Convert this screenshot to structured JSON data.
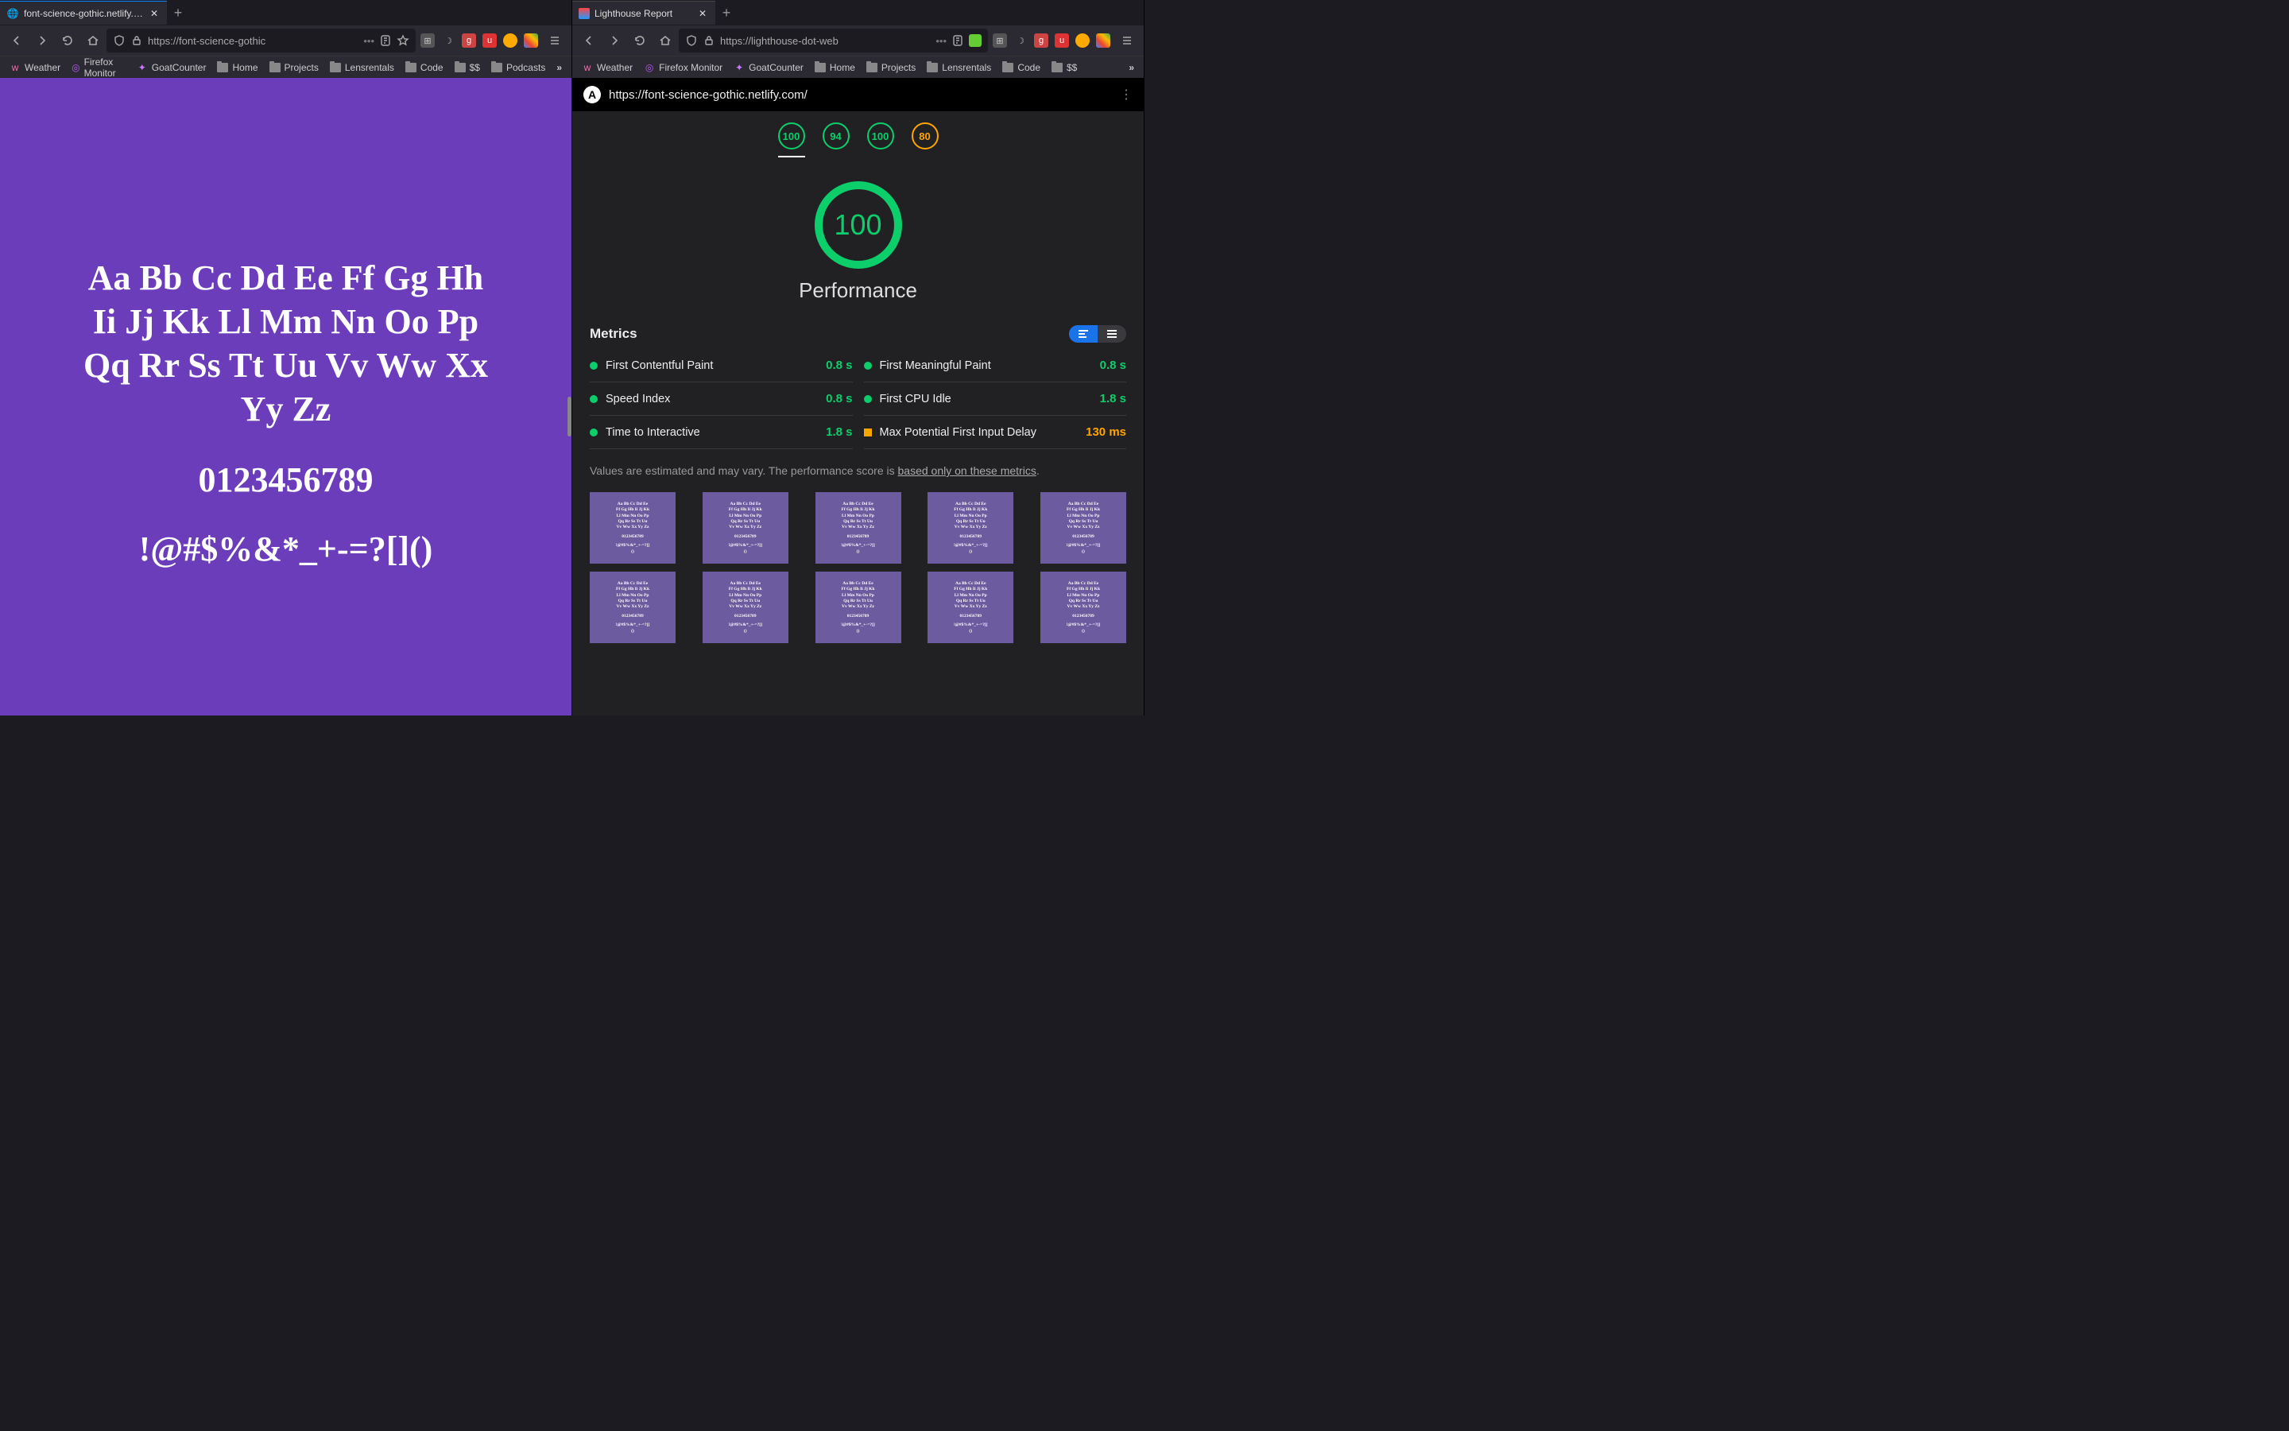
{
  "left": {
    "tab": {
      "title": "font-science-gothic.netlify.com/"
    },
    "url": "https://font-science-gothic",
    "bookmarks": [
      "Weather",
      "Firefox Monitor",
      "GoatCounter",
      "Home",
      "Projects",
      "Lensrentals",
      "Code",
      "$$",
      "Podcasts"
    ],
    "specimen": {
      "row1": "Aa Bb Cc Dd Ee Ff Gg Hh",
      "row2": "Ii Jj Kk Ll Mm Nn Oo Pp",
      "row3": "Qq Rr Ss Tt Uu Vv Ww Xx",
      "row4": "Yy Zz",
      "nums": "0123456789",
      "syms": "!@#$%&*_+-=?[]()"
    }
  },
  "right": {
    "tab": {
      "title": "Lighthouse Report"
    },
    "url": "https://lighthouse-dot-web",
    "bookmarks": [
      "Weather",
      "Firefox Monitor",
      "GoatCounter",
      "Home",
      "Projects",
      "Lensrentals",
      "Code",
      "$$"
    ],
    "lh": {
      "url": "https://font-science-gothic.netlify.com/",
      "scores": [
        {
          "value": "100",
          "class": "green",
          "active": true
        },
        {
          "value": "94",
          "class": "green"
        },
        {
          "value": "100",
          "class": "green"
        },
        {
          "value": "80",
          "class": "orange"
        }
      ],
      "gauge": {
        "value": "100",
        "label": "Performance"
      },
      "metrics_title": "Metrics",
      "metrics": [
        {
          "name": "First Contentful Paint",
          "value": "0.8 s",
          "status": "green"
        },
        {
          "name": "First Meaningful Paint",
          "value": "0.8 s",
          "status": "green"
        },
        {
          "name": "Speed Index",
          "value": "0.8 s",
          "status": "green"
        },
        {
          "name": "First CPU Idle",
          "value": "1.8 s",
          "status": "green"
        },
        {
          "name": "Time to Interactive",
          "value": "1.8 s",
          "status": "green"
        },
        {
          "name": "Max Potential First Input Delay",
          "value": "130 ms",
          "status": "orange"
        }
      ],
      "note_pre": "Values are estimated and may vary. The performance score is ",
      "note_link": "based only on these metrics",
      "note_post": ".",
      "frame": {
        "l1": "Aa Bb Cc Dd Ee",
        "l2": "Ff Gg Hh Ii Jj Kk",
        "l3": "Ll Mm Nn Oo Pp",
        "l4": "Qq Rr Ss Tt Uu",
        "l5": "Vv Ww Xx Yy Zz",
        "l6": "0123456789",
        "l7": "!@#$%&*_+-=?[]",
        "l8": "()"
      }
    }
  }
}
